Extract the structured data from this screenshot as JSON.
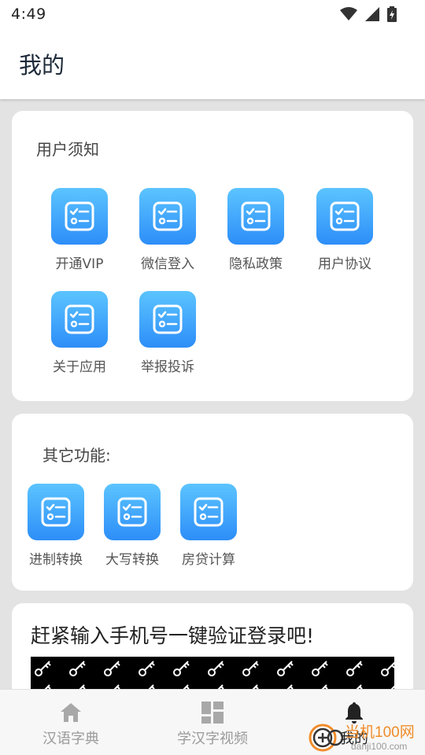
{
  "status_bar": {
    "time": "4:49",
    "icons": [
      "wifi-icon",
      "signal-icon",
      "battery-charging-icon"
    ]
  },
  "header": {
    "title": "我的"
  },
  "user_notice": {
    "title": "用户须知",
    "items": [
      {
        "label": "开通VIP",
        "icon": "checklist-icon"
      },
      {
        "label": "微信登入",
        "icon": "checklist-icon"
      },
      {
        "label": "隐私政策",
        "icon": "checklist-icon"
      },
      {
        "label": "用户协议",
        "icon": "checklist-icon"
      },
      {
        "label": "关于应用",
        "icon": "checklist-icon"
      },
      {
        "label": "举报投诉",
        "icon": "checklist-icon"
      }
    ]
  },
  "other_functions": {
    "title": "其它功能:",
    "items": [
      {
        "label": "进制转换",
        "icon": "checklist-icon"
      },
      {
        "label": "大写转换",
        "icon": "checklist-icon"
      },
      {
        "label": "房贷计算",
        "icon": "checklist-icon"
      }
    ]
  },
  "promo": {
    "title": "赶紧输入手机号一键验证登录吧!"
  },
  "bottom_nav": {
    "items": [
      {
        "label": "汉语字典",
        "icon": "home-icon",
        "active": false
      },
      {
        "label": "学汉字视频",
        "icon": "dashboard-icon",
        "active": false
      },
      {
        "label": "我的",
        "icon": "bell-icon",
        "active": true
      }
    ]
  },
  "watermark": {
    "text": "当机100网",
    "sub": "danji100.com"
  },
  "colors": {
    "tile_gradient_top": "#5cc4ff",
    "tile_gradient_bottom": "#2d8ef8",
    "background": "#e3e3e3",
    "card": "#ffffff"
  }
}
